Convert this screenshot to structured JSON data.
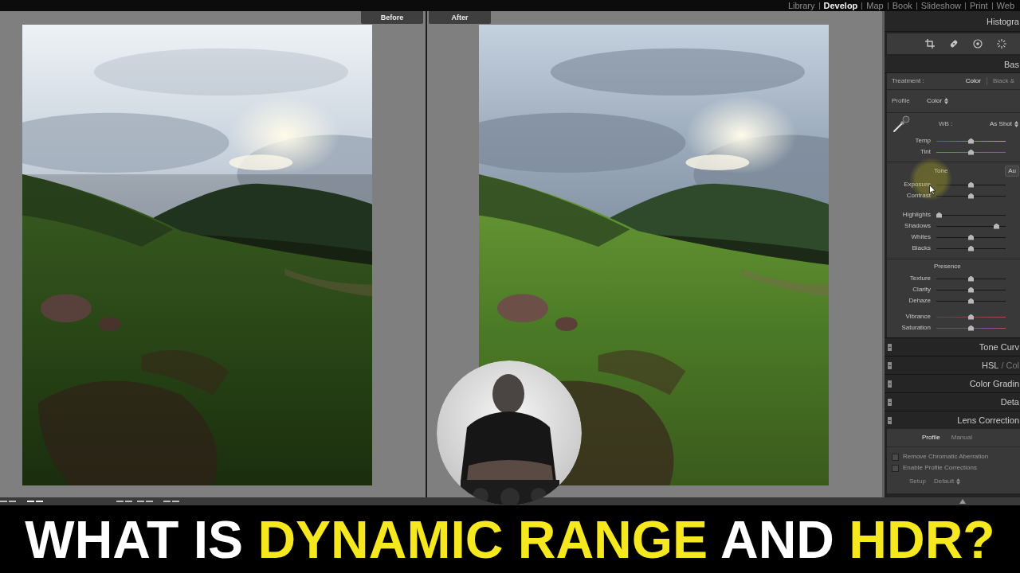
{
  "top_bar": {
    "modules": [
      {
        "label": "Library",
        "selected": false
      },
      {
        "label": "Develop",
        "selected": true
      },
      {
        "label": "Map",
        "selected": false
      },
      {
        "label": "Book",
        "selected": false
      },
      {
        "label": "Slideshow",
        "selected": false
      },
      {
        "label": "Print",
        "selected": false
      },
      {
        "label": "Web",
        "selected": false
      }
    ]
  },
  "compare_view": {
    "panes": [
      {
        "label": "Before"
      },
      {
        "label": "After"
      }
    ]
  },
  "right_panel": {
    "histogram_title": "Histogra",
    "basic": {
      "title": "Bas",
      "treatment": {
        "label": "Treatment :",
        "options": [
          {
            "label": "Color",
            "selected": true
          },
          {
            "label": "Black &",
            "selected": false
          }
        ]
      },
      "profile": {
        "label": "Profile",
        "value": "Color"
      },
      "white_balance": {
        "label": "WB :",
        "value": "As Shot",
        "sliders": [
          {
            "name": "Temp",
            "kind": "temp",
            "level": 0.5
          },
          {
            "name": "Tint",
            "kind": "tint",
            "level": 0.5
          }
        ]
      },
      "tone": {
        "label": "Tone",
        "auto": "Au",
        "groups": [
          [
            {
              "name": "Exposure",
              "kind": "plain",
              "level": 0.5
            },
            {
              "name": "Contrast",
              "kind": "plain",
              "level": 0.5
            }
          ],
          [
            {
              "name": "Highlights",
              "kind": "plain",
              "level": 0
            },
            {
              "name": "Shadows",
              "kind": "plain",
              "level": 0.9
            },
            {
              "name": "Whites",
              "kind": "plain",
              "level": 0.5
            },
            {
              "name": "Blacks",
              "kind": "plain",
              "level": 0.5
            }
          ]
        ]
      },
      "presence": {
        "label": "Presence",
        "groups": [
          [
            {
              "name": "Texture",
              "kind": "plain",
              "level": 0.5
            },
            {
              "name": "Clarity",
              "kind": "plain",
              "level": 0.5
            },
            {
              "name": "Dehaze",
              "kind": "plain",
              "level": 0.5
            }
          ],
          [
            {
              "name": "Vibrance",
              "kind": "vibrance",
              "level": 0.5
            },
            {
              "name": "Saturation",
              "kind": "saturation",
              "level": 0.5
            }
          ]
        ]
      }
    },
    "panels": [
      {
        "title": "Tone Curv"
      },
      {
        "title": "HSL",
        "subtitle": "/ Col"
      },
      {
        "title": "Color Gradin"
      },
      {
        "title": "Deta"
      }
    ],
    "lens_corrections": {
      "title": "Lens Correction",
      "tabs": [
        {
          "label": "Profile",
          "selected": true
        },
        {
          "label": "Manual",
          "selected": false
        }
      ],
      "options": [
        {
          "label": "Remove Chromatic Aberration",
          "checked": false
        },
        {
          "label": "Enable Profile Corrections",
          "checked": false
        }
      ],
      "setup": {
        "label": "Setup",
        "value": "Default"
      }
    }
  },
  "headline": {
    "parts": [
      {
        "text": "WHAT IS",
        "color": "#ffffff"
      },
      {
        "text": "DYNAMIC RANGE",
        "color": "#f6e81e"
      },
      {
        "text": "AND",
        "color": "#ffffff"
      },
      {
        "text": "HDR?",
        "color": "#f6e81e"
      }
    ]
  }
}
